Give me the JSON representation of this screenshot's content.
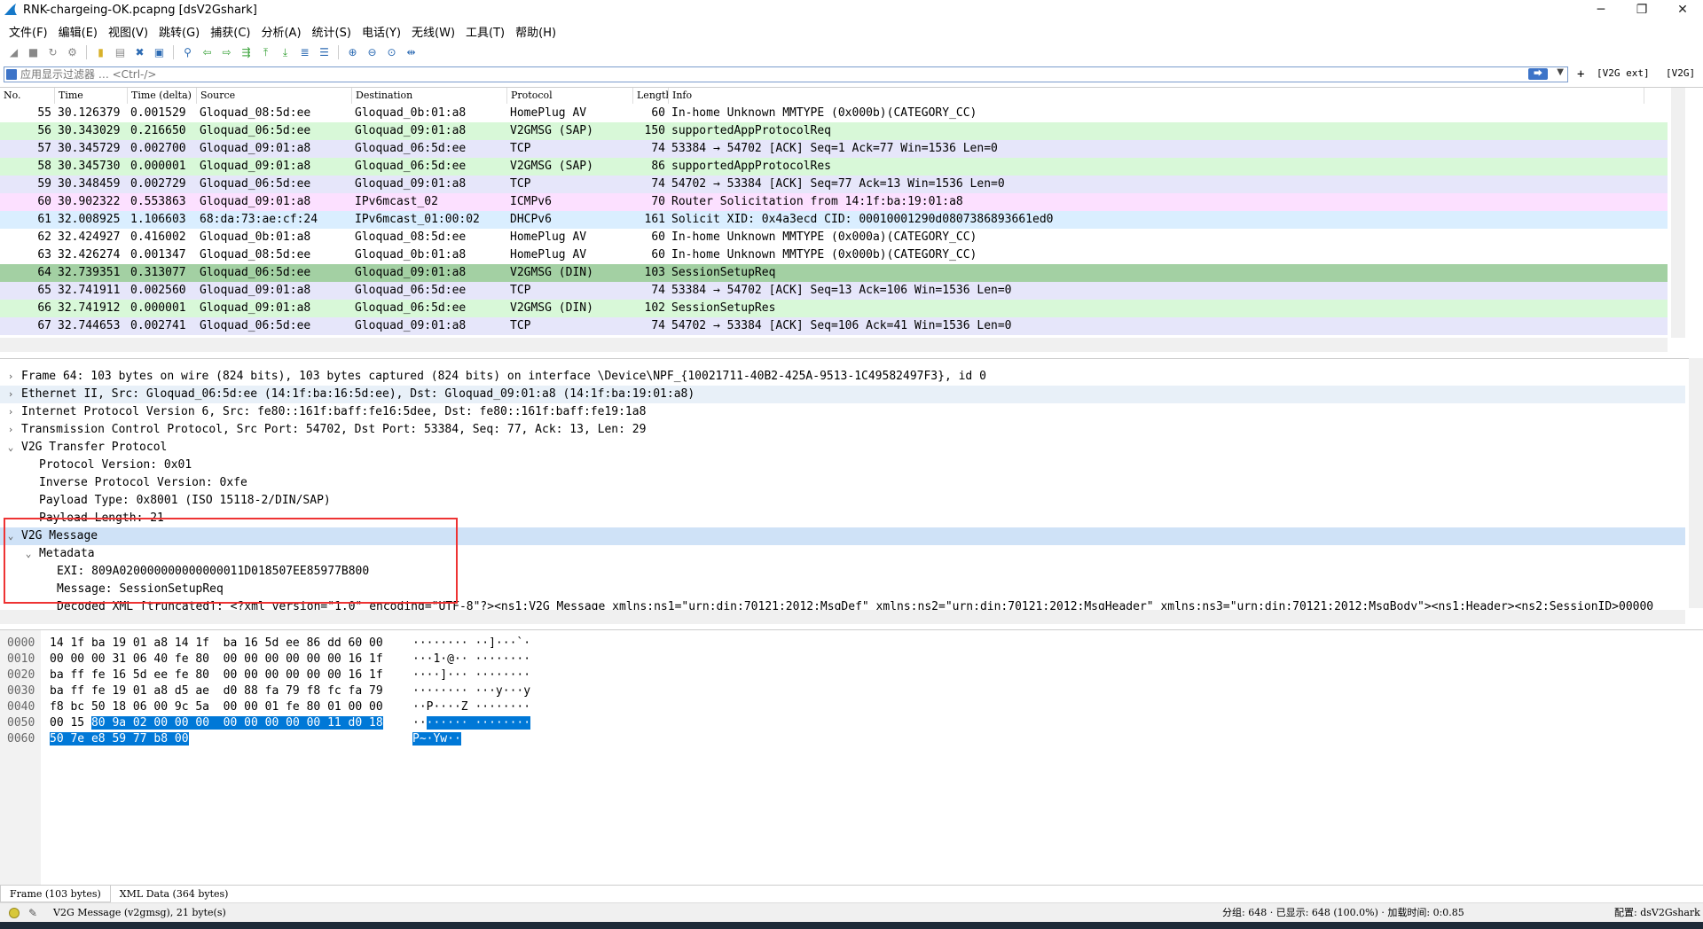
{
  "window": {
    "title": "RNK-chargeing-OK.pcapng [dsV2Gshark]",
    "minimize": "─",
    "maximize": "❐",
    "close": "✕"
  },
  "menu": [
    "文件(F)",
    "编辑(E)",
    "视图(V)",
    "跳转(G)",
    "捕获(C)",
    "分析(A)",
    "统计(S)",
    "电话(Y)",
    "无线(W)",
    "工具(T)",
    "帮助(H)"
  ],
  "filter": {
    "placeholder": "应用显示过滤器 … <Ctrl-/>",
    "plus": "+",
    "btn1": "[V2G ext]",
    "btn2": "[V2G]"
  },
  "packet_list": {
    "columns": [
      "No.",
      "Time",
      "Time (delta)",
      "Source",
      "Destination",
      "Protocol",
      "Length",
      "Info"
    ],
    "rows": [
      {
        "no": "55",
        "time": "30.126379",
        "delta": "0.001529",
        "src": "Gloquad_08:5d:ee",
        "dst": "Gloquad_0b:01:a8",
        "proto": "HomePlug AV",
        "len": "60",
        "info": "In-home Unknown MMTYPE (0x000b)(CATEGORY_CC)",
        "bg": "#ffffff"
      },
      {
        "no": "56",
        "time": "30.343029",
        "delta": "0.216650",
        "src": "Gloquad_06:5d:ee",
        "dst": "Gloquad_09:01:a8",
        "proto": "V2GMSG (SAP)",
        "len": "150",
        "info": "supportedAppProtocolReq",
        "bg": "#d8f8d8"
      },
      {
        "no": "57",
        "time": "30.345729",
        "delta": "0.002700",
        "src": "Gloquad_09:01:a8",
        "dst": "Gloquad_06:5d:ee",
        "proto": "TCP",
        "len": "74",
        "info": "53384 → 54702 [ACK] Seq=1 Ack=77 Win=1536 Len=0",
        "bg": "#e6e6fa"
      },
      {
        "no": "58",
        "time": "30.345730",
        "delta": "0.000001",
        "src": "Gloquad_09:01:a8",
        "dst": "Gloquad_06:5d:ee",
        "proto": "V2GMSG (SAP)",
        "len": "86",
        "info": "supportedAppProtocolRes",
        "bg": "#d8f8d8"
      },
      {
        "no": "59",
        "time": "30.348459",
        "delta": "0.002729",
        "src": "Gloquad_06:5d:ee",
        "dst": "Gloquad_09:01:a8",
        "proto": "TCP",
        "len": "74",
        "info": "54702 → 53384 [ACK] Seq=77 Ack=13 Win=1536 Len=0",
        "bg": "#e6e6fa"
      },
      {
        "no": "60",
        "time": "30.902322",
        "delta": "0.553863",
        "src": "Gloquad_09:01:a8",
        "dst": "IPv6mcast_02",
        "proto": "ICMPv6",
        "len": "70",
        "info": "Router Solicitation from 14:1f:ba:19:01:a8",
        "bg": "#fce0ff"
      },
      {
        "no": "61",
        "time": "32.008925",
        "delta": "1.106603",
        "src": "68:da:73:ae:cf:24",
        "dst": "IPv6mcast_01:00:02",
        "proto": "DHCPv6",
        "len": "161",
        "info": "Solicit XID: 0x4a3ecd CID: 00010001290d0807386893661ed0",
        "bg": "#daeeff"
      },
      {
        "no": "62",
        "time": "32.424927",
        "delta": "0.416002",
        "src": "Gloquad_0b:01:a8",
        "dst": "Gloquad_08:5d:ee",
        "proto": "HomePlug AV",
        "len": "60",
        "info": "In-home Unknown MMTYPE (0x000a)(CATEGORY_CC)",
        "bg": "#ffffff"
      },
      {
        "no": "63",
        "time": "32.426274",
        "delta": "0.001347",
        "src": "Gloquad_08:5d:ee",
        "dst": "Gloquad_0b:01:a8",
        "proto": "HomePlug AV",
        "len": "60",
        "info": "In-home Unknown MMTYPE (0x000b)(CATEGORY_CC)",
        "bg": "#ffffff"
      },
      {
        "no": "64",
        "time": "32.739351",
        "delta": "0.313077",
        "src": "Gloquad_06:5d:ee",
        "dst": "Gloquad_09:01:a8",
        "proto": "V2GMSG (DIN)",
        "len": "103",
        "info": "SessionSetupReq",
        "bg": "#a3d0a3"
      },
      {
        "no": "65",
        "time": "32.741911",
        "delta": "0.002560",
        "src": "Gloquad_09:01:a8",
        "dst": "Gloquad_06:5d:ee",
        "proto": "TCP",
        "len": "74",
        "info": "53384 → 54702 [ACK] Seq=13 Ack=106 Win=1536 Len=0",
        "bg": "#e6e6fa"
      },
      {
        "no": "66",
        "time": "32.741912",
        "delta": "0.000001",
        "src": "Gloquad_09:01:a8",
        "dst": "Gloquad_06:5d:ee",
        "proto": "V2GMSG (DIN)",
        "len": "102",
        "info": "SessionSetupRes",
        "bg": "#d8f8d8"
      },
      {
        "no": "67",
        "time": "32.744653",
        "delta": "0.002741",
        "src": "Gloquad_06:5d:ee",
        "dst": "Gloquad_09:01:a8",
        "proto": "TCP",
        "len": "74",
        "info": "54702 → 53384 [ACK] Seq=106 Ack=41 Win=1536 Len=0",
        "bg": "#e6e6fa"
      }
    ]
  },
  "details": [
    {
      "arrow": "›",
      "indent": 0,
      "text": "Frame 64: 103 bytes on wire (824 bits), 103 bytes captured (824 bits) on interface \\Device\\NPF_{10021711-40B2-425A-9513-1C49582497F3}, id 0",
      "bg": "#ffffff"
    },
    {
      "arrow": "›",
      "indent": 0,
      "text": "Ethernet II, Src: Gloquad_06:5d:ee (14:1f:ba:16:5d:ee), Dst: Gloquad_09:01:a8 (14:1f:ba:19:01:a8)",
      "bg": "#e8f0f8"
    },
    {
      "arrow": "›",
      "indent": 0,
      "text": "Internet Protocol Version 6, Src: fe80::161f:baff:fe16:5dee, Dst: fe80::161f:baff:fe19:1a8",
      "bg": "#ffffff"
    },
    {
      "arrow": "›",
      "indent": 0,
      "text": "Transmission Control Protocol, Src Port: 54702, Dst Port: 53384, Seq: 77, Ack: 13, Len: 29",
      "bg": "#ffffff"
    },
    {
      "arrow": "⌄",
      "indent": 0,
      "text": "V2G Transfer Protocol",
      "bg": "#ffffff"
    },
    {
      "arrow": "",
      "indent": 1,
      "text": "Protocol Version: 0x01",
      "bg": "#ffffff"
    },
    {
      "arrow": "",
      "indent": 1,
      "text": "Inverse Protocol Version: 0xfe",
      "bg": "#ffffff"
    },
    {
      "arrow": "",
      "indent": 1,
      "text": "Payload Type: 0x8001 (ISO 15118-2/DIN/SAP)",
      "bg": "#ffffff"
    },
    {
      "arrow": "",
      "indent": 1,
      "text": "Payload Length: 21",
      "bg": "#ffffff"
    },
    {
      "arrow": "⌄",
      "indent": 0,
      "text": "V2G Message",
      "bg": "#cfe2f7"
    },
    {
      "arrow": "⌄",
      "indent": 1,
      "text": "Metadata",
      "bg": "#ffffff"
    },
    {
      "arrow": "",
      "indent": 2,
      "text": "EXI: 809A020000000000000011D018507EE85977B800",
      "bg": "#ffffff"
    },
    {
      "arrow": "",
      "indent": 2,
      "text": "Message: SessionSetupReq",
      "bg": "#ffffff"
    },
    {
      "arrow": "",
      "indent": 2,
      "text": "Decoded XML [truncated]: <?xml version=\"1.0\" encoding=\"UTF-8\"?><ns1:V2G_Message xmlns:ns1=\"urn:din:70121:2012:MsgDef\" xmlns:ns2=\"urn:din:70121:2012:MsgHeader\" xmlns:ns3=\"urn:din:70121:2012:MsgBody\"><ns1:Header><ns2:SessionID>00000",
      "bg": "#ffffff"
    }
  ],
  "bytes": [
    {
      "off": "0000",
      "hex": "14 1f ba 19 01 a8 14 1f  ba 16 5d ee 86 dd 60 00",
      "asc": "········ ··]···`·",
      "sel_hex_from": -1,
      "sel_asc_from": -1
    },
    {
      "off": "0010",
      "hex": "00 00 00 31 06 40 fe 80  00 00 00 00 00 00 16 1f",
      "asc": "···1·@·· ········",
      "sel_hex_from": -1,
      "sel_asc_from": -1
    },
    {
      "off": "0020",
      "hex": "ba ff fe 16 5d ee fe 80  00 00 00 00 00 00 16 1f",
      "asc": "····]··· ········",
      "sel_hex_from": -1,
      "sel_asc_from": -1
    },
    {
      "off": "0030",
      "hex": "ba ff fe 19 01 a8 d5 ae  d0 88 fa 79 f8 fc fa 79",
      "asc": "········ ···y···y",
      "sel_hex_from": -1,
      "sel_asc_from": -1
    },
    {
      "off": "0040",
      "hex": "f8 bc 50 18 06 00 9c 5a  00 00 01 fe 80 01 00 00",
      "asc": "··P····Z ········",
      "sel_hex_from": -1,
      "sel_asc_from": -1
    },
    {
      "off": "0050",
      "hex": "00 15 80 9a 02 00 00 00  00 00 00 00 00 11 d0 18",
      "asc": "········ ········",
      "sel_hex_from": 6,
      "sel_asc_from": 2
    },
    {
      "off": "0060",
      "hex": "50 7e e8 59 77 b8 00",
      "asc": "P~·Yw··",
      "sel_hex_from": 0,
      "sel_asc_from": 0
    }
  ],
  "byte_tabs": [
    "Frame (103 bytes)",
    "XML Data (364 bytes)"
  ],
  "status": {
    "field": "V2G Message (v2gmsg), 21 byte(s)",
    "packets": "分组: 648 · 已显示: 648 (100.0%) · 加载时间: 0:0.85",
    "profile": "配置: dsV2Gshark"
  },
  "colors": {
    "accent": "#0078d7",
    "highlight_box": "#e33333"
  }
}
